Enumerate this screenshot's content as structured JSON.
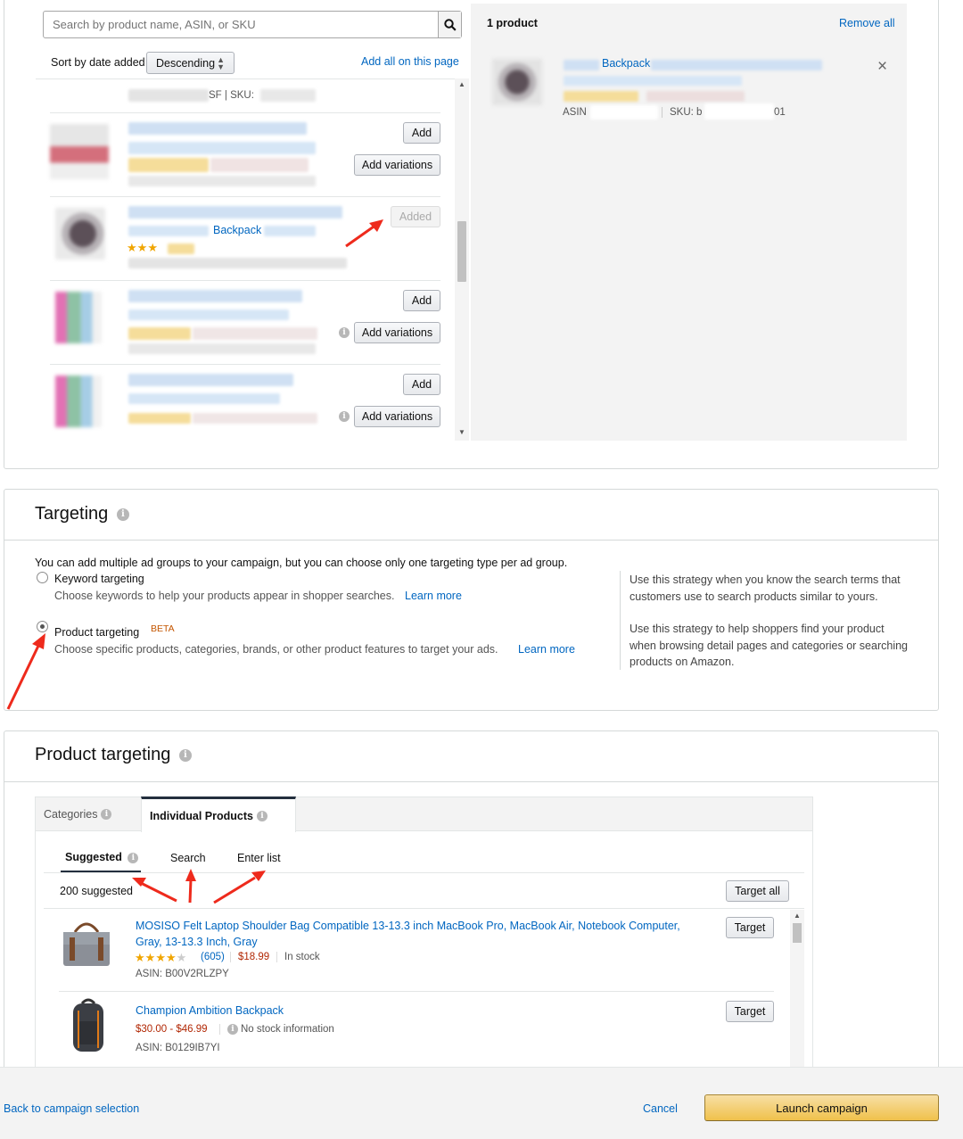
{
  "products_panel": {
    "search_placeholder": "Search by product name, ASIN, or SKU",
    "sort_label": "Sort by date added",
    "sort_value": "Descending",
    "add_all_label": "Add all on this page",
    "first_row_partial": "SF | SKU:",
    "rows": [
      {
        "add_label": "Add",
        "variations_label": "Add variations"
      },
      {
        "added_label": "Added",
        "title_fragment": "Backpack"
      },
      {
        "add_label": "Add",
        "variations_label": "Add variations"
      },
      {
        "add_label": "Add",
        "variations_label": "Add variations"
      }
    ]
  },
  "selected_panel": {
    "count_label": "1 product",
    "remove_all_label": "Remove all",
    "item_title_fragment": "Backpack",
    "asin_fragment": "ASIN",
    "sku_fragment": "SKU: b",
    "sku_end": "01",
    "remove_glyph": "×"
  },
  "targeting": {
    "title": "Targeting",
    "intro": "You can add multiple ad groups to your campaign, but you can choose only one targeting type per ad group.",
    "keyword_label": "Keyword targeting",
    "keyword_desc": "Choose keywords to help your products appear in shopper searches.",
    "keyword_learn": "Learn more",
    "product_label": "Product targeting",
    "product_badge": "BETA",
    "product_desc": "Choose specific products, categories, brands, or other product features to target your ads.",
    "product_learn": "Learn more",
    "help_keyword": "Use this strategy when you know the search terms that customers use to search products similar to yours.",
    "help_product": "Use this strategy to help shoppers find your product when browsing detail pages and categories or searching products on Amazon.",
    "selected": "Product targeting"
  },
  "product_targeting": {
    "title": "Product targeting",
    "tabs": [
      {
        "label": "Categories"
      },
      {
        "label": "Individual Products"
      }
    ],
    "active_tab": "Individual Products",
    "subtabs": [
      {
        "label": "Suggested"
      },
      {
        "label": "Search"
      },
      {
        "label": "Enter list"
      }
    ],
    "active_subtab": "Suggested",
    "suggested_count": "200 suggested",
    "target_all_label": "Target all",
    "products": [
      {
        "title_line1": "MOSISO Felt Laptop Shoulder Bag Compatible 13-13.3 inch MacBook Pro, MacBook Air, Notebook Computer,",
        "title_line2": "Gray, 13-13.3 Inch, Gray",
        "rating": 4,
        "reviews": "(605)",
        "price": "$18.99",
        "stock": "In stock",
        "asin": "ASIN: B00V2RLZPY",
        "button": "Target"
      },
      {
        "title_line1": "Champion Ambition Backpack",
        "price": "$30.00 - $46.99",
        "stock": "No stock information",
        "asin": "ASIN: B0129IB7YI",
        "button": "Target"
      }
    ]
  },
  "footer": {
    "back_label": "Back to campaign selection",
    "cancel_label": "Cancel",
    "launch_label": "Launch campaign"
  },
  "colors": {
    "link": "#0066c0",
    "price": "#b12704",
    "beta": "#c45500",
    "launch_button": "#f0c14b",
    "annotation_arrow": "#ee2a1c"
  },
  "icons": [
    "search-icon",
    "sort-caret-icon",
    "info-icon",
    "star-icon",
    "close-icon",
    "scroll-up-icon",
    "scroll-down-icon",
    "radio-icon",
    "annotation-arrow"
  ]
}
